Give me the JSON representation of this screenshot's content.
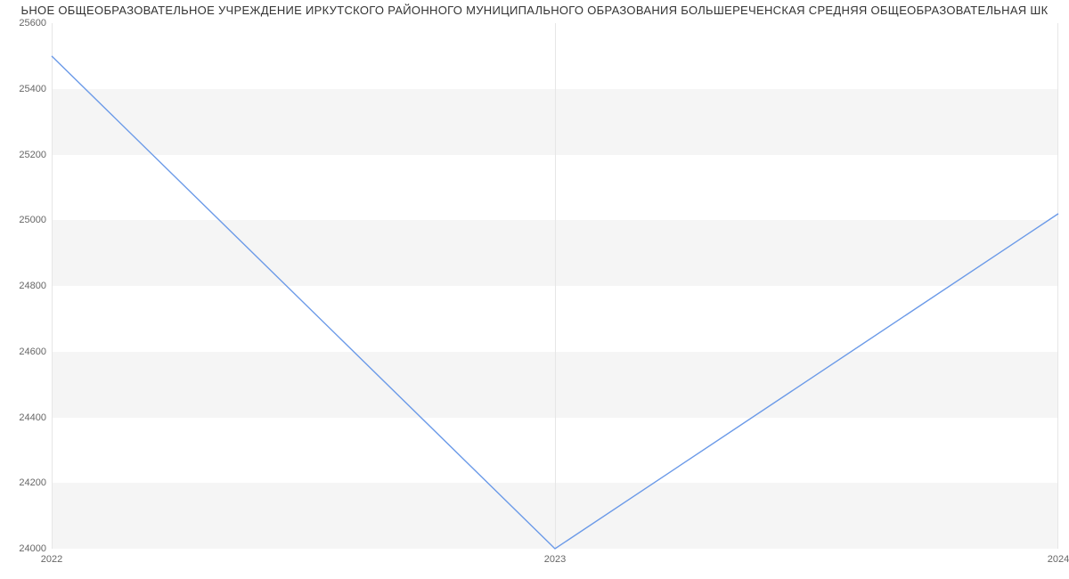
{
  "chart_data": {
    "type": "line",
    "title": "ЬНОЕ ОБЩЕОБРАЗОВАТЕЛЬНОЕ УЧРЕЖДЕНИЕ ИРКУТСКОГО РАЙОННОГО МУНИЦИПАЛЬНОГО ОБРАЗОВАНИЯ БОЛЬШЕРЕЧЕНСКАЯ СРЕДНЯЯ ОБЩЕОБРАЗОВАТЕЛЬНАЯ ШК",
    "x": [
      2022,
      2023,
      2024
    ],
    "values": [
      25500,
      24000,
      25020
    ],
    "xlabel": "",
    "ylabel": "",
    "xlim": [
      2022,
      2024
    ],
    "ylim": [
      24000,
      25600
    ],
    "y_ticks": [
      24000,
      24200,
      24400,
      24600,
      24800,
      25000,
      25200,
      25400,
      25600
    ],
    "x_ticks": [
      2022,
      2023,
      2024
    ],
    "line_color": "#6b9ae8"
  },
  "y_tick_labels": {
    "t0": "24000",
    "t1": "24200",
    "t2": "24400",
    "t3": "24600",
    "t4": "24800",
    "t5": "25000",
    "t6": "25200",
    "t7": "25400",
    "t8": "25600"
  },
  "x_tick_labels": {
    "t0": "2022",
    "t1": "2023",
    "t2": "2024"
  }
}
